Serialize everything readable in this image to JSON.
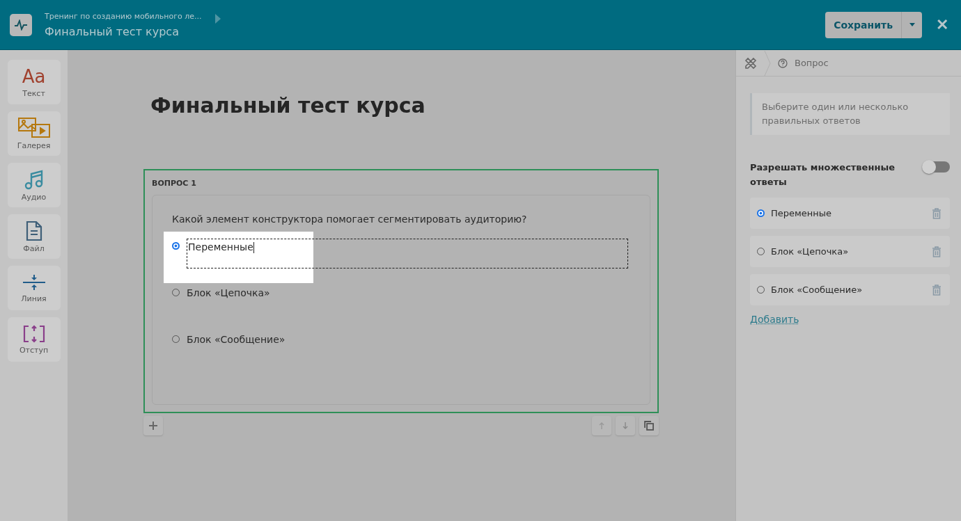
{
  "header": {
    "breadcrumb": "Тренинг по созданию мобильного ле...",
    "title": "Финальный тест курса",
    "save_button": "Сохранить",
    "close": "✕"
  },
  "tools": [
    {
      "kind": "text",
      "glyph": "Aa",
      "label": "Текст"
    },
    {
      "kind": "gallery",
      "label": "Галерея"
    },
    {
      "kind": "audio",
      "label": "Аудио"
    },
    {
      "kind": "file",
      "label": "Файл"
    },
    {
      "kind": "line",
      "label": "Линия"
    },
    {
      "kind": "spacing",
      "label": "Отступ"
    }
  ],
  "page_title": "Финальный тест курса",
  "question": {
    "label": "ВОПРОС 1",
    "text": "Какой элемент конструктора помогает сегментировать аудиторию?",
    "answers": [
      {
        "text": "Переменные",
        "selected": true,
        "editing": true
      },
      {
        "text": "Блок «Цепочка»",
        "selected": false,
        "editing": false
      },
      {
        "text": "Блок «Сообщение»",
        "selected": false,
        "editing": false
      }
    ]
  },
  "panel": {
    "breadcrumb": "Вопрос",
    "hint": "Выберите один или несколько правильных ответов",
    "multiple_label": "Разрешать множественные ответы",
    "multiple_on": false,
    "answers": [
      {
        "text": "Переменные",
        "selected": true
      },
      {
        "text": "Блок «Цепочка»",
        "selected": false
      },
      {
        "text": "Блок «Сообщение»",
        "selected": false
      }
    ],
    "add_link": "Добавить"
  }
}
